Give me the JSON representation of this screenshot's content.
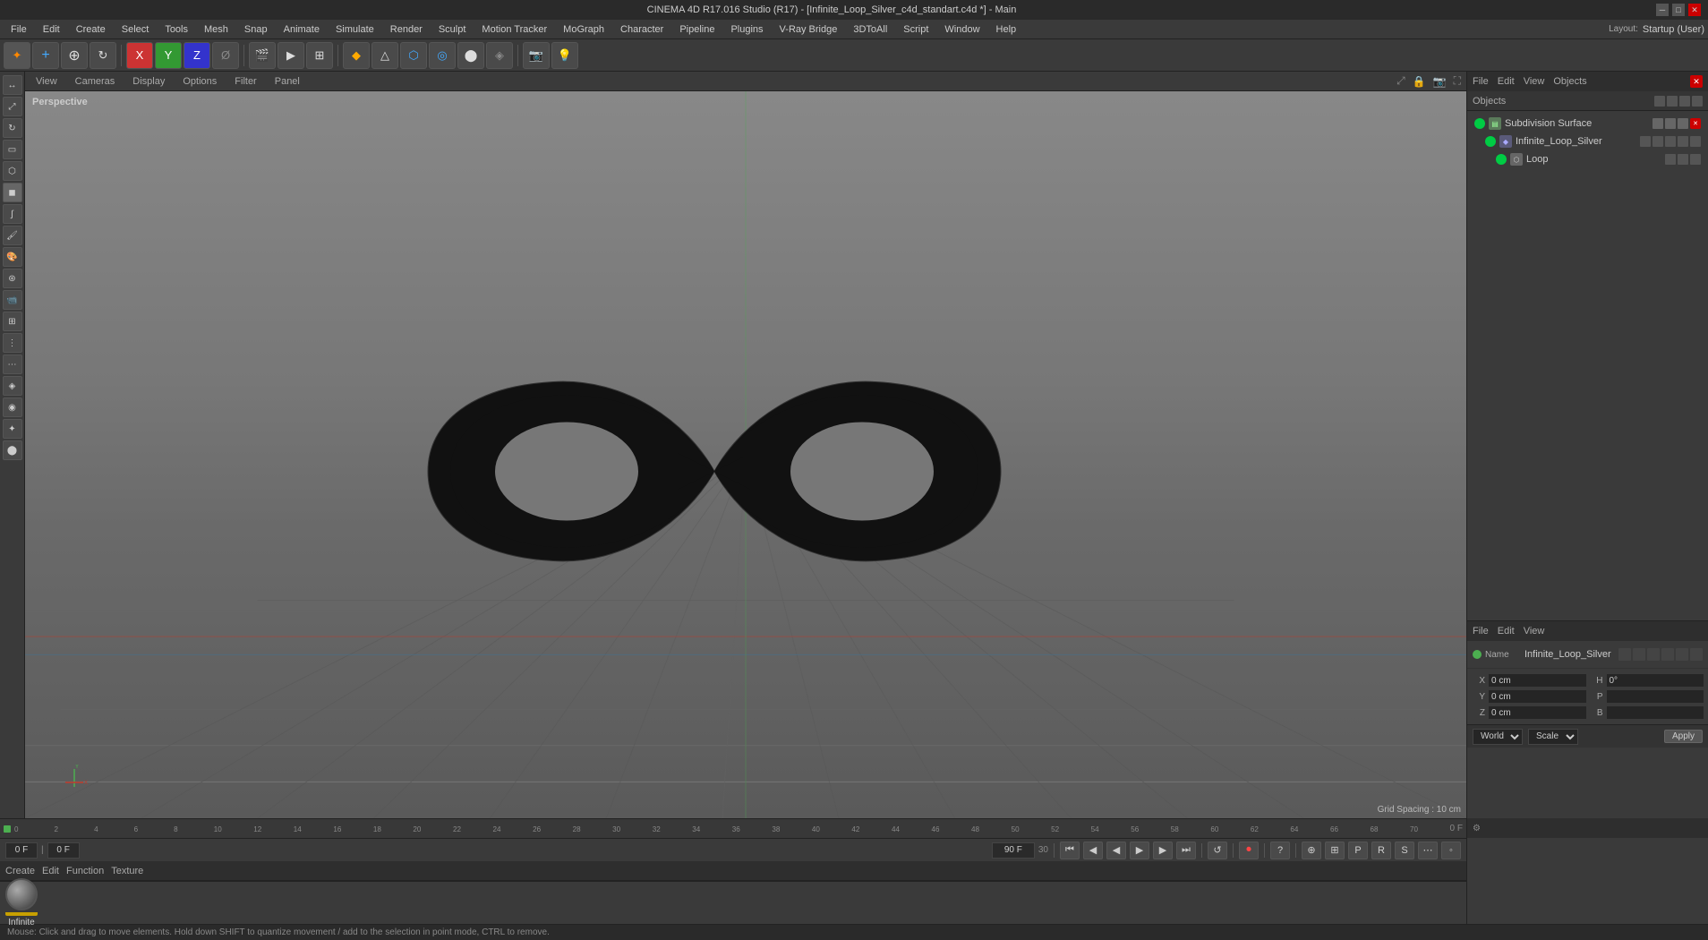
{
  "titleBar": {
    "title": "CINEMA 4D R17.016 Studio (R17) - [Infinite_Loop_Silver_c4d_standart.c4d *] - Main"
  },
  "menuBar": {
    "items": [
      "File",
      "Edit",
      "Create",
      "Select",
      "Tools",
      "Mesh",
      "Snap",
      "Animate",
      "Simulate",
      "Render",
      "Sculpt",
      "Motion Tracker",
      "MoGraph",
      "Character",
      "Pipeline",
      "Plugins",
      "V-Ray Bridge",
      "3DToAll",
      "Script",
      "Window",
      "Help"
    ]
  },
  "viewport": {
    "label": "Perspective",
    "tabs": [
      "View",
      "Cameras",
      "Display",
      "Options",
      "Filter",
      "Panel"
    ],
    "gridSpacing": "Grid Spacing : 10 cm"
  },
  "objectManager": {
    "title": "Objects",
    "menuItems": [
      "File",
      "Edit",
      "View",
      "Objects"
    ],
    "objects": [
      {
        "name": "Subdivision Surface",
        "type": "subdivision",
        "color": "#00cc44",
        "indent": 0
      },
      {
        "name": "Infinite_Loop_Silver",
        "type": "object",
        "color": "#00cc44",
        "indent": 1
      },
      {
        "name": "Loop",
        "type": "mesh",
        "color": "#00cc44",
        "indent": 2
      }
    ]
  },
  "attributesPanel": {
    "menuItems": [
      "File",
      "Edit",
      "View"
    ],
    "selectedObject": "Infinite_Loop_Silver",
    "coordinates": {
      "x": {
        "label": "X",
        "pos": "0 cm",
        "size": ""
      },
      "y": {
        "label": "Y",
        "pos": "0 cm",
        "size": ""
      },
      "z": {
        "label": "Z",
        "pos": "0 cm",
        "size": ""
      },
      "h": {
        "label": "H",
        "rot": "0°"
      },
      "p": {
        "label": "P",
        "rot": ""
      },
      "b": {
        "label": "B",
        "rot": ""
      }
    },
    "coordLabels": {
      "world": "World",
      "scale": "Scale",
      "apply": "Apply"
    }
  },
  "timeline": {
    "currentFrame": "0 F",
    "startFrame": "0 F",
    "endFrame": "90 F",
    "fps": "30",
    "outputFrame": "0 F"
  },
  "materialBar": {
    "menuItems": [
      "Create",
      "Edit",
      "Function",
      "Texture"
    ],
    "materials": [
      {
        "name": "Infinite",
        "hasLabel": true
      }
    ]
  },
  "statusBar": {
    "text": "Mouse: Click and drag to move elements. Hold down SHIFT to quantize movement / add to the selection in point mode, CTRL to remove."
  },
  "layout": {
    "label": "Layout:",
    "value": "Startup (User)"
  },
  "playback": {
    "buttons": [
      "⏮",
      "◀◀",
      "◀",
      "▶",
      "▶▶",
      "⏭",
      "⏺"
    ],
    "loopBtn": "↺",
    "recBtn": "⏺"
  }
}
